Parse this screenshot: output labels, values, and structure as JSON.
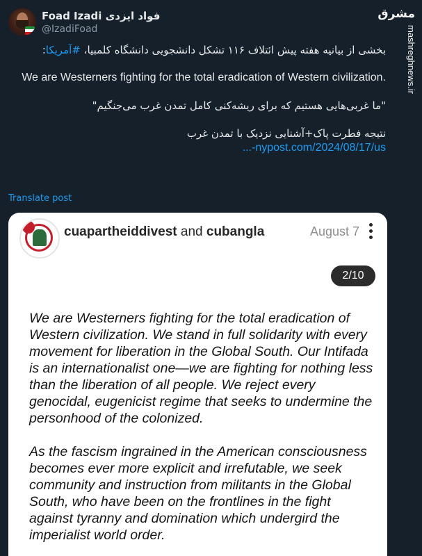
{
  "author": {
    "display_name": "Foad Izadi فواد ایزدی",
    "handle": "@IzadiFoad"
  },
  "watermark": {
    "logo_text": "مشرق",
    "url": "mashreghnews.ir"
  },
  "tweet": {
    "line1_text": "بخشی از بیانیه هفته پیش ائتلاف ۱۱۶ تشکل دانشجویی دانشگاه کلمبیا، ",
    "line1_hashtag": "#آمریکا",
    "line1_suffix": ":",
    "english_quote": "We are Westerners fighting for the total eradication of Western civilization.",
    "persian_quote": "\"ما غربی‌هایی هستیم که برای ریشه‌کنی کامل تمدن غرب می‌جنگیم\"",
    "conclusion": "نتیجه فطرت پاک+آشنایی نزدیک با تمدن غرب",
    "link_text": "nypost.com/2024/08/17/us-..."
  },
  "translate_label": "Translate post",
  "card": {
    "account1": "cuapartheiddivest",
    "connector": "and",
    "account2": "cubangla",
    "date": "August 7",
    "slide_counter": "2/10",
    "paragraph1": "We are Westerners fighting for the total eradication of Western civilization. We stand in full solidarity with every movement for liberation in the Global South. Our Intifada is an internationalist one—we are fighting for nothing less than the liberation of all people. We reject every genocidal, eugenicist regime that seeks to undermine the personhood of the colonized.",
    "paragraph2": "As the fascism ingrained in the American consciousness becomes ever more explicit and irrefutable, we seek community and instruction from militants in the Global South, who have been on the frontlines in the fight against tyranny and domination which undergird the imperialist world order."
  },
  "colors": {
    "background": "#15202b",
    "link": "#1d9bf0",
    "text": "#e7e9ea",
    "muted": "#8b98a5"
  }
}
